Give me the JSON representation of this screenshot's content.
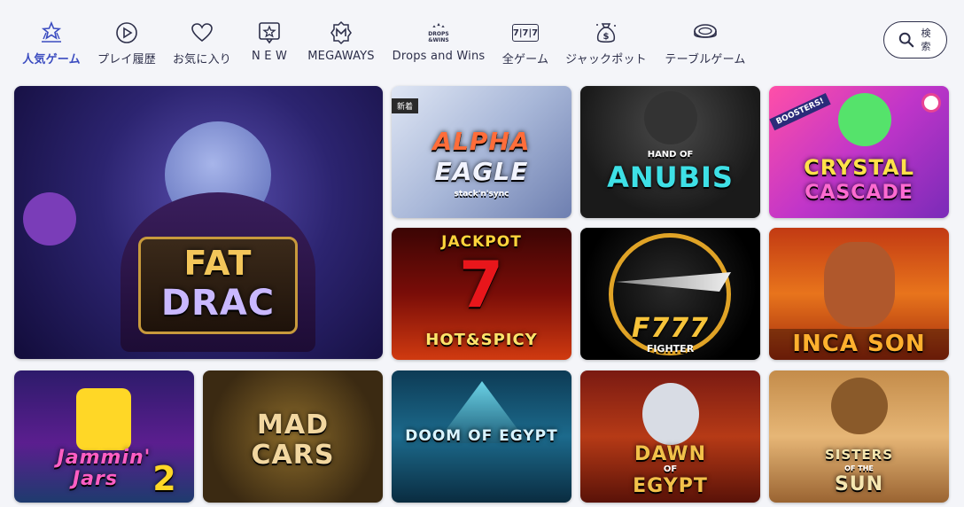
{
  "nav": {
    "items": [
      {
        "label": "人気ゲーム",
        "icon": "stars-trophy-icon",
        "active": true
      },
      {
        "label": "プレイ履歴",
        "icon": "play-history-icon",
        "active": false
      },
      {
        "label": "お気に入り",
        "icon": "heart-icon",
        "active": false
      },
      {
        "label": "N E W",
        "icon": "new-star-icon",
        "active": false
      },
      {
        "label": "MEGAWAYS",
        "icon": "megaways-icon",
        "active": false
      },
      {
        "label": "Drops and Wins",
        "icon": "drops-and-wins-icon",
        "active": false
      },
      {
        "label": "全ゲーム",
        "icon": "slot-777-icon",
        "active": false
      },
      {
        "label": "ジャックポット",
        "icon": "money-bag-icon",
        "active": false
      },
      {
        "label": "テーブルゲーム",
        "icon": "table-game-icon",
        "active": false
      }
    ],
    "drops_icon_text": [
      "DROPS",
      "&WINS"
    ],
    "slot_icon_text": "7|7|7"
  },
  "search": {
    "label": "検索",
    "label_top": "検",
    "label_bottom": "索",
    "icon": "search-icon"
  },
  "games": [
    {
      "title_line1": "FAT",
      "title_line2": "DRAC"
    },
    {
      "title_line1": "ALPHA",
      "title_line2": "EAGLE",
      "sub": "stack'n'sync",
      "badge": "新着"
    },
    {
      "title_top": "HAND OF",
      "title": "ANUBIS"
    },
    {
      "title_line1": "CRYSTAL",
      "title_line2": "CASCADE",
      "ribbon": "BOOSTERS!"
    },
    {
      "title_top": "JACKPOT",
      "title_mid": "7",
      "title": "HOT&SPICY"
    },
    {
      "title": "F777",
      "sub": "FIGHTER"
    },
    {
      "title": "INCA SON"
    },
    {
      "title_line1": "Jammin'",
      "title_line2": "Jars",
      "num": "2"
    },
    {
      "title_line1": "MAD",
      "title_line2": "CARS"
    },
    {
      "title": "DOOM OF EGYPT"
    },
    {
      "title_line1": "DAWN",
      "title_mid": "OF",
      "title_line2": "EGYPT"
    },
    {
      "title_line1": "SISTERS",
      "title_mid": "OF THE",
      "title_line2": "SUN"
    }
  ],
  "colors": {
    "accent": "#3b4cc0",
    "text": "#2d2f4a",
    "background": "#f4f5f9"
  }
}
